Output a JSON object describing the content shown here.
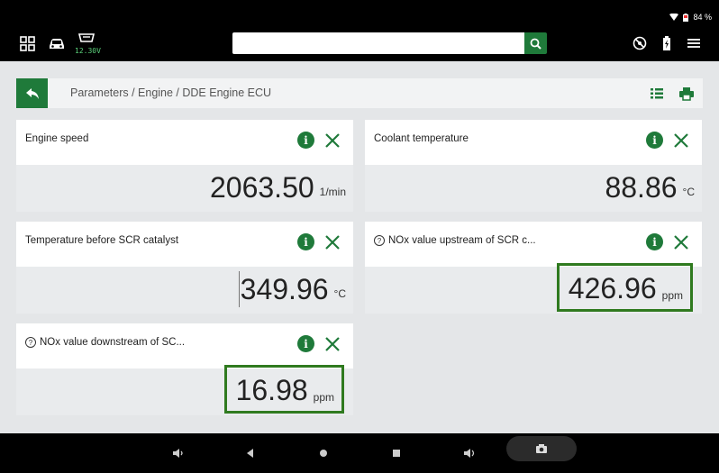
{
  "status": {
    "battery": "84 %"
  },
  "topbar": {
    "voltage": "12.30V",
    "search_placeholder": ""
  },
  "breadcrumb": "Parameters / Engine / DDE Engine ECU",
  "cards": [
    {
      "title": "Engine speed",
      "value": "2063.50",
      "unit": "1/min",
      "help": false
    },
    {
      "title": "Coolant temperature",
      "value": "88.86",
      "unit": "°C",
      "help": false
    },
    {
      "title": "Temperature before SCR catalyst",
      "value": "349.96",
      "unit": "°C",
      "help": false
    },
    {
      "title": "NOx value upstream of SCR c...",
      "value": "426.96",
      "unit": "ppm",
      "help": true
    },
    {
      "title": "NOx value downstream of SC...",
      "value": "16.98",
      "unit": "ppm",
      "help": true
    }
  ],
  "colors": {
    "accent": "#1f7a3a",
    "highlight": "#2f7a1f",
    "background": "#e4e6e8"
  }
}
